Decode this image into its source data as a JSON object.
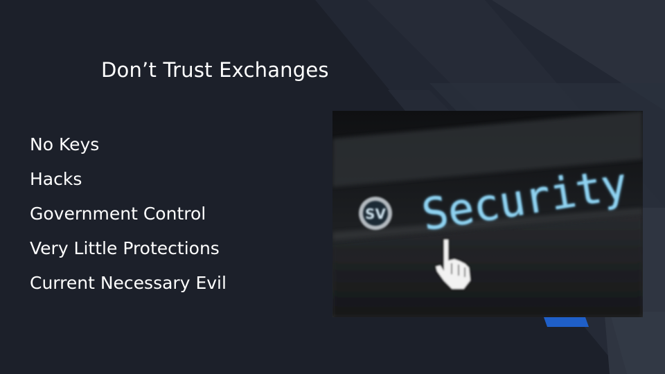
{
  "slide": {
    "title": "Don’t Trust Exchanges",
    "bullets": [
      "No Keys",
      "Hacks",
      "Government Control",
      "Very Little Protections",
      "Current Necessary Evil"
    ],
    "image": {
      "word": "Security",
      "badge_text": "SV"
    }
  },
  "colors": {
    "background": "#1c202a",
    "text": "#ffffff",
    "accent_blue": "#1f5fc8",
    "security_text": "#7ec8e8"
  }
}
